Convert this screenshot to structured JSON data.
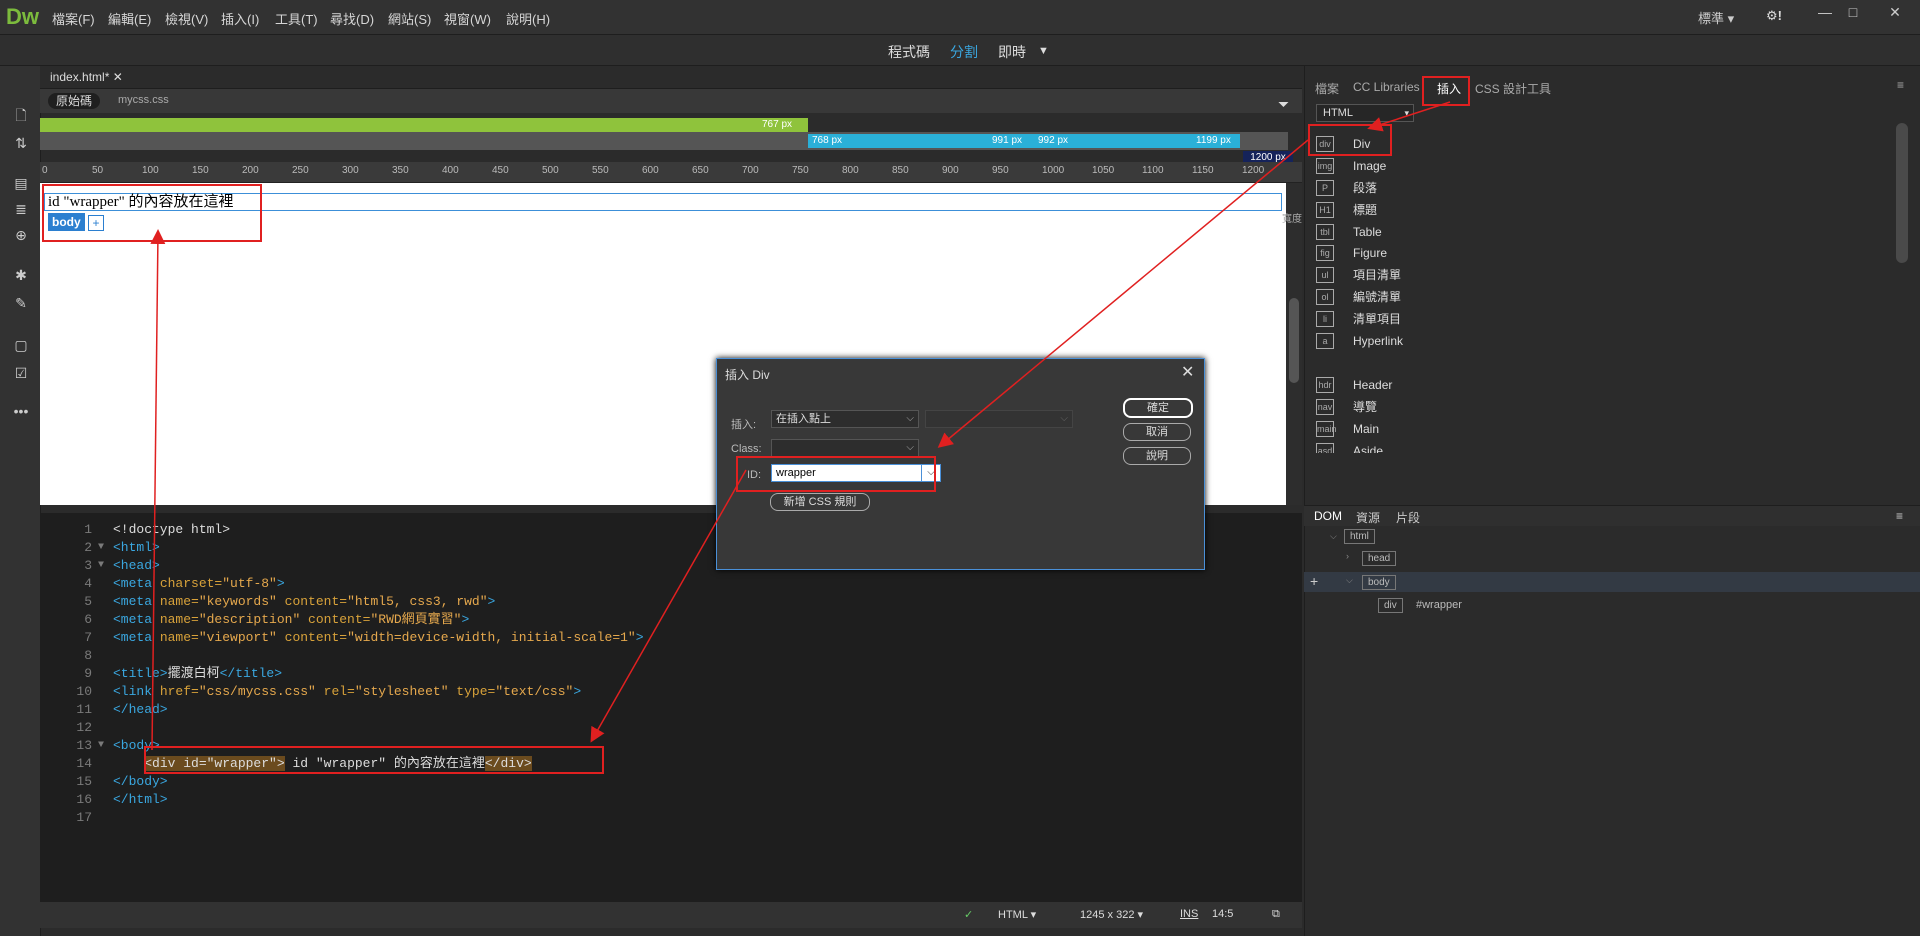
{
  "app": {
    "logo": "Dw"
  },
  "menu": [
    "檔案(F)",
    "編輯(E)",
    "檢視(V)",
    "插入(I)",
    "工具(T)",
    "尋找(D)",
    "網站(S)",
    "視窗(W)",
    "說明(H)"
  ],
  "workspace": {
    "label": "標準",
    "gear": "⚙!"
  },
  "window_controls": [
    "—",
    "□",
    "✕"
  ],
  "views": {
    "code": "程式碼",
    "split": "分割",
    "live": "即時"
  },
  "doc_tab": {
    "label": "index.html*"
  },
  "related_files": {
    "source": "原始碼",
    "css": "mycss.css"
  },
  "media_queries": {
    "max1": "767 px",
    "min2": "768 px",
    "max2": "991 px",
    "min3": "992 px",
    "max3": "1199 px",
    "end": "1200 px"
  },
  "ruler_ticks": [
    "0",
    "50",
    "100",
    "150",
    "200",
    "250",
    "300",
    "350",
    "400",
    "450",
    "500",
    "550",
    "600",
    "650",
    "700",
    "750",
    "800",
    "850",
    "900",
    "950",
    "1000",
    "1050",
    "1100",
    "1150",
    "1200"
  ],
  "design": {
    "content": "id \"wrapper\" 的內容放在這裡",
    "body_tag": "body",
    "plus": "+",
    "side_label": "寬度"
  },
  "code_lines": [
    {
      "n": "1",
      "fold": "",
      "parts": [
        [
          "p",
          "<!doctype html>"
        ]
      ]
    },
    {
      "n": "2",
      "fold": "▼",
      "parts": [
        [
          "t",
          "<html>"
        ]
      ]
    },
    {
      "n": "3",
      "fold": "▼",
      "parts": [
        [
          "t",
          "<head>"
        ]
      ]
    },
    {
      "n": "4",
      "fold": "",
      "parts": [
        [
          "t",
          "<meta "
        ],
        [
          "a",
          "charset="
        ],
        [
          "v",
          "\"utf-8\""
        ],
        [
          "t",
          ">"
        ]
      ]
    },
    {
      "n": "5",
      "fold": "",
      "parts": [
        [
          "t",
          "<meta "
        ],
        [
          "a",
          "name="
        ],
        [
          "v",
          "\"keywords\" "
        ],
        [
          "a",
          "content="
        ],
        [
          "v",
          "\"html5, css3, rwd\""
        ],
        [
          "t",
          ">"
        ]
      ]
    },
    {
      "n": "6",
      "fold": "",
      "parts": [
        [
          "t",
          "<meta "
        ],
        [
          "a",
          "name="
        ],
        [
          "v",
          "\"description\" "
        ],
        [
          "a",
          "content="
        ],
        [
          "v",
          "\"RWD網頁實習\""
        ],
        [
          "t",
          ">"
        ]
      ]
    },
    {
      "n": "7",
      "fold": "",
      "parts": [
        [
          "t",
          "<meta "
        ],
        [
          "a",
          "name="
        ],
        [
          "v",
          "\"viewport\" "
        ],
        [
          "a",
          "content="
        ],
        [
          "v",
          "\"width=device-width, initial-scale=1\""
        ],
        [
          "t",
          ">"
        ]
      ]
    },
    {
      "n": "8",
      "fold": "",
      "parts": []
    },
    {
      "n": "9",
      "fold": "",
      "parts": [
        [
          "t",
          "<title>"
        ],
        [
          "p",
          "擺渡白柯"
        ],
        [
          "t",
          "</title>"
        ]
      ]
    },
    {
      "n": "10",
      "fold": "",
      "parts": [
        [
          "t",
          "<link "
        ],
        [
          "a",
          "href="
        ],
        [
          "v",
          "\"css/mycss.css\" "
        ],
        [
          "a",
          "rel="
        ],
        [
          "v",
          "\"stylesheet\" "
        ],
        [
          "a",
          "type="
        ],
        [
          "v",
          "\"text/css\""
        ],
        [
          "t",
          ">"
        ]
      ]
    },
    {
      "n": "11",
      "fold": "",
      "parts": [
        [
          "t",
          "</head>"
        ]
      ]
    },
    {
      "n": "12",
      "fold": "",
      "parts": []
    },
    {
      "n": "13",
      "fold": "▼",
      "parts": [
        [
          "t",
          "<body>"
        ]
      ]
    },
    {
      "n": "14",
      "fold": "",
      "parts": [
        [
          "p",
          "    "
        ],
        [
          "hl",
          "<div id=\"wrapper\">"
        ],
        [
          "p",
          " id \"wrapper\" 的內容放在這裡"
        ],
        [
          "hl",
          "</div>"
        ]
      ]
    },
    {
      "n": "15",
      "fold": "",
      "parts": [
        [
          "t",
          "</body>"
        ]
      ]
    },
    {
      "n": "16",
      "fold": "",
      "parts": [
        [
          "t",
          "</html>"
        ]
      ]
    },
    {
      "n": "17",
      "fold": "",
      "parts": []
    }
  ],
  "status": {
    "lang": "HTML",
    "size": "1245 x 322",
    "mode": "INS",
    "pos": "14:5"
  },
  "panel_tabs": [
    "檔案",
    "CC Libraries",
    "插入",
    "CSS 設計工具"
  ],
  "insert_category": "HTML",
  "insert_items": [
    {
      "icon": "div",
      "label": "Div"
    },
    {
      "icon": "img",
      "label": "Image"
    },
    {
      "icon": "P",
      "label": "段落"
    },
    {
      "icon": "H1",
      "label": "標題"
    },
    {
      "icon": "tbl",
      "label": "Table"
    },
    {
      "icon": "fig",
      "label": "Figure"
    },
    {
      "icon": "ul",
      "label": "項目清單"
    },
    {
      "icon": "ol",
      "label": "編號清單"
    },
    {
      "icon": "li",
      "label": "清單項目"
    },
    {
      "icon": "a",
      "label": "Hyperlink"
    },
    {
      "icon": "hdr",
      "label": "Header"
    },
    {
      "icon": "nav",
      "label": "導覽"
    },
    {
      "icon": "main",
      "label": "Main"
    },
    {
      "icon": "asd",
      "label": "Aside"
    }
  ],
  "dom_tabs": [
    "DOM",
    "資源",
    "片段"
  ],
  "dom_tree": {
    "html": "html",
    "head": "head",
    "body": "body",
    "div": "div",
    "div_id": "#wrapper"
  },
  "dialog": {
    "title": "插入 Div",
    "insert_label": "插入:",
    "insert_value": "在插入點上",
    "class_label": "Class:",
    "id_label": "ID:",
    "id_value": "wrapper",
    "new_css": "新增 CSS 規則",
    "ok": "確定",
    "cancel": "取消",
    "help": "說明"
  }
}
